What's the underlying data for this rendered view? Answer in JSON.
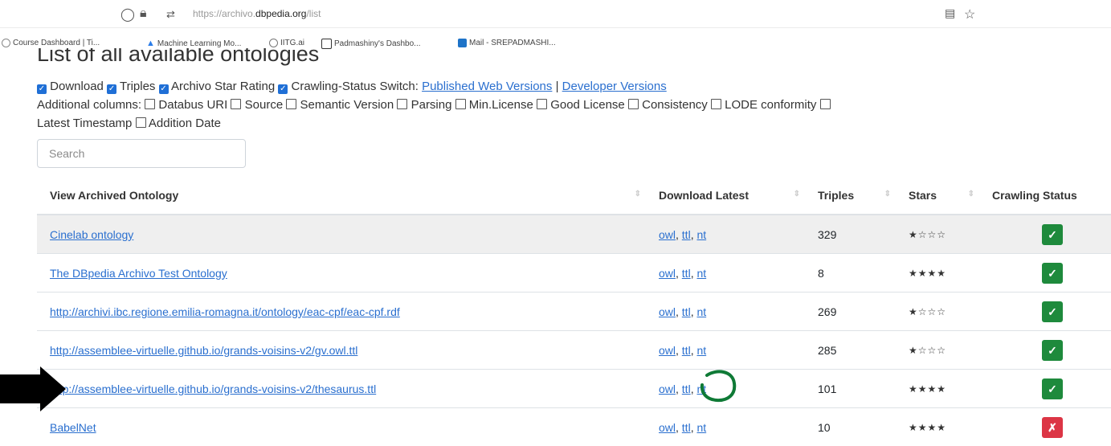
{
  "browser": {
    "url_prefix": "https://archivo.",
    "url_domain": "dbpedia.org",
    "url_path": "/list",
    "bookmarks": [
      {
        "label": "Course Dashboard | Ti...",
        "color": "#888888"
      },
      {
        "label": "Machine Learning Mo...",
        "color": "#2b7de9"
      },
      {
        "label": "IITG.ai",
        "color": "#777777"
      },
      {
        "label": "Padmashiny's Dashbo...",
        "color": "#333333"
      },
      {
        "label": "Mail - SREPADMASHI...",
        "color": "#1e73c8"
      }
    ]
  },
  "page": {
    "title": "List of all available ontologies",
    "toggles": [
      "Download",
      "Triples",
      "Archivo Star Rating",
      "Crawling-Status Switch:"
    ],
    "published_link": "Published Web Versions",
    "separator": "|",
    "developer_link": "Developer Versions",
    "additional_label": "Additional columns:",
    "additional_columns": [
      "Databus URI",
      "Source",
      "Semantic Version",
      "Parsing",
      "Min.License",
      "Good License",
      "Consistency",
      "LODE conformity",
      "Latest Timestamp",
      "Addition Date"
    ]
  },
  "search": {
    "placeholder": "Search"
  },
  "table": {
    "headers": [
      "View Archived Ontology",
      "Download Latest",
      "Triples",
      "Stars",
      "Crawling Status"
    ],
    "download_links": [
      "owl",
      "ttl",
      "nt"
    ],
    "rows": [
      {
        "name": "Cinelab ontology",
        "triples": "329",
        "stars": "★☆☆☆",
        "status": "ok"
      },
      {
        "name": "The DBpedia Archivo Test Ontology",
        "triples": "8",
        "stars": "★★★★",
        "status": "ok"
      },
      {
        "name": "http://archivi.ibc.regione.emilia-romagna.it/ontology/eac-cpf/eac-cpf.rdf",
        "triples": "269",
        "stars": "★☆☆☆",
        "status": "ok"
      },
      {
        "name": "http://assemblee-virtuelle.github.io/grands-voisins-v2/gv.owl.ttl",
        "triples": "285",
        "stars": "★☆☆☆",
        "status": "ok"
      },
      {
        "name": "http://assemblee-virtuelle.github.io/grands-voisins-v2/thesaurus.ttl",
        "triples": "101",
        "stars": "★★★★",
        "status": "ok"
      },
      {
        "name": "BabelNet",
        "triples": "10",
        "stars": "★★★★",
        "status": "fail"
      }
    ],
    "status_symbols": {
      "ok": "✓",
      "fail": "✗"
    },
    "status_colors": {
      "ok": "#1e8a3c",
      "fail": "#dc3545"
    }
  },
  "annotations": {
    "arrow_color": "#000000",
    "circle_color": "#0f7a36"
  }
}
